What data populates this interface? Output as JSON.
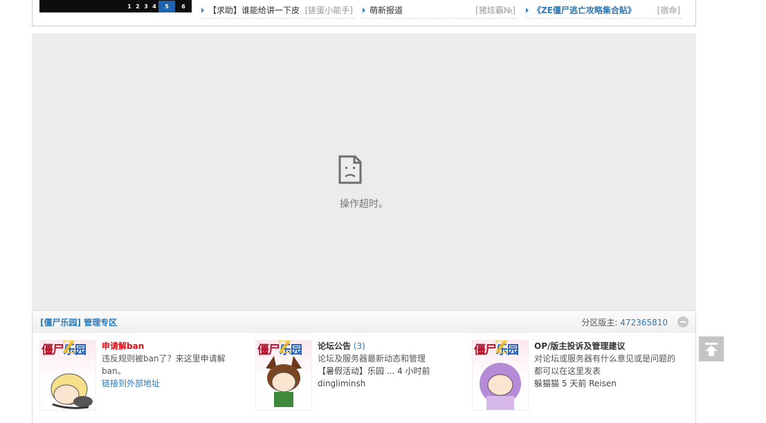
{
  "slideshow": {
    "pages": [
      "1",
      "2",
      "3",
      "4",
      "5",
      "6"
    ],
    "active_page": "5"
  },
  "news": [
    {
      "title": "【求助】谁能给讲一下皮",
      "author": "[搓蛋小能手]"
    },
    {
      "title": "萌新报道",
      "author": "[猪炫霸№]"
    },
    {
      "title": "《ZE僵尸逃亡攻略集合贴》",
      "author": "[宿命]"
    }
  ],
  "error": {
    "icon": "sad-page-icon",
    "message": "操作超时。"
  },
  "category": {
    "title": "[僵尸乐园] 管理专区",
    "moderator_label": "分区版主:",
    "moderator": "472365810"
  },
  "forums": [
    {
      "logo_text": "僵尸乐园",
      "name": "申请解ban",
      "count": "",
      "description": "违反规则被ban了？来这里申请解ban。",
      "link": "链接到外部地址",
      "last_post": "",
      "last_author": ""
    },
    {
      "logo_text": "僵尸乐园",
      "name": "论坛公告",
      "count": "(3)",
      "description": "论坛及服务器最新动态和管理",
      "link": "",
      "last_post": "【暑假活动】乐园 ... 4 小时前",
      "last_author": "dingliminsh"
    },
    {
      "logo_text": "僵尸乐园",
      "name": "OP/版主投诉及管理建议",
      "count": "",
      "description": "对论坛或服务器有什么意见或是问题的都可以在这里发表",
      "link": "",
      "last_post": "躲猫猫 5 天前 Reisen",
      "last_author": ""
    }
  ],
  "colors": {
    "accent_blue": "#2b7ab8",
    "forum_red": "#d9111a",
    "error_bg": "#ececec",
    "active_page": "#1f62b0"
  }
}
